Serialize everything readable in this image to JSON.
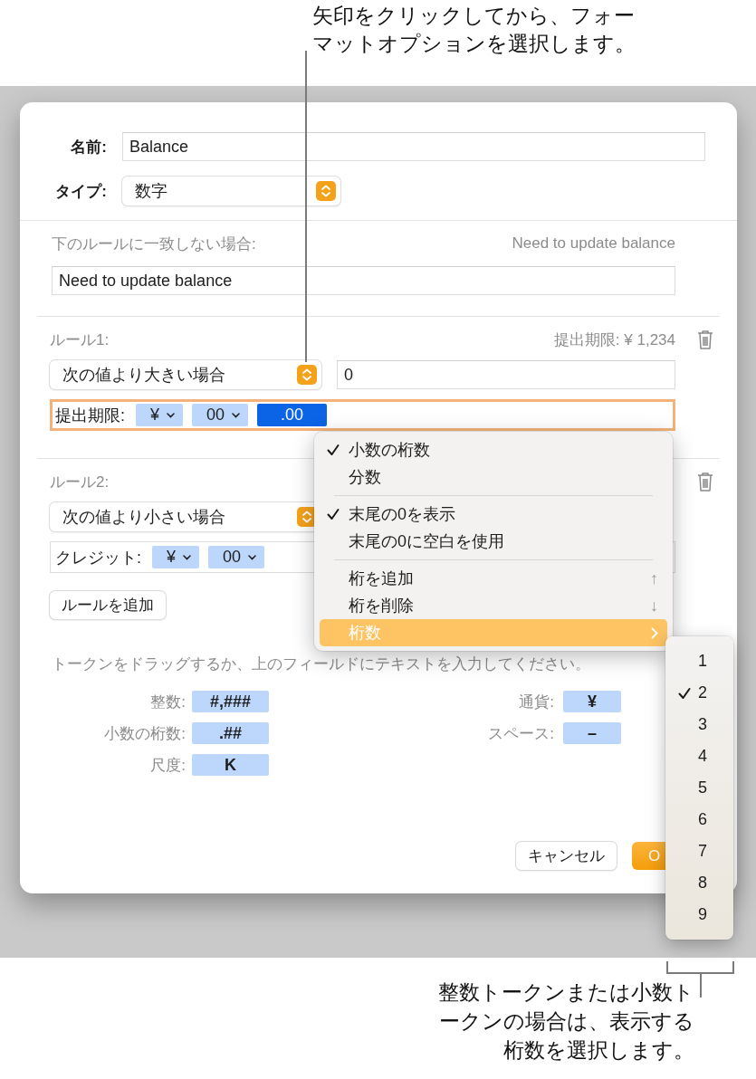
{
  "callout_top": "矢印をクリックしてから、フォーマットオプションを選択します。",
  "dialog": {
    "name": {
      "label": "名前:",
      "value": "Balance"
    },
    "type": {
      "label": "タイプ:",
      "value": "数字"
    },
    "fallback": {
      "label": "下のルールに一致しない場合:",
      "preview": "Need to update balance",
      "value": "Need to update balance"
    },
    "rules": [
      {
        "label": "ルール1:",
        "preview": "提出期限: ¥ 1,234",
        "condition": "次の値より大きい場合",
        "value": "0",
        "format_label": "提出期限:",
        "focused": true,
        "tokens": [
          {
            "text": "¥",
            "dropdown": true,
            "selected": false
          },
          {
            "text": "00",
            "dropdown": true,
            "selected": false
          },
          {
            "text": ".00",
            "dropdown": false,
            "selected": true
          }
        ]
      },
      {
        "label": "ルール2:",
        "condition": "次の値より小さい場合",
        "format_label": "クレジット:",
        "focused": false,
        "tokens": [
          {
            "text": "¥",
            "dropdown": true,
            "selected": false
          },
          {
            "text": "00",
            "dropdown": true,
            "selected": false
          }
        ]
      }
    ],
    "add_rule": "ルールを追加",
    "hint": "トークンをドラッグするか、上のフィールドにテキストを入力してください。",
    "palette_left": [
      {
        "label": "整数:",
        "token": "#,###"
      },
      {
        "label": "小数の桁数:",
        "token": ".##"
      },
      {
        "label": "尺度:",
        "token": "K"
      }
    ],
    "palette_right": [
      {
        "label": "通貨:",
        "token": "¥"
      },
      {
        "label": "スペース:",
        "token": "–"
      }
    ],
    "buttons": [
      {
        "label": "キャンセル",
        "kind": "cancel"
      },
      {
        "label": "O",
        "kind": "default"
      }
    ]
  },
  "format_menu": [
    {
      "kind": "item",
      "label": "小数の桁数",
      "checked": true,
      "highlighted": false
    },
    {
      "kind": "item",
      "label": "分数",
      "checked": false,
      "highlighted": false
    },
    {
      "kind": "separator"
    },
    {
      "kind": "item",
      "label": "末尾の0を表示",
      "checked": true,
      "highlighted": false
    },
    {
      "kind": "item",
      "label": "末尾の0に空白を使用",
      "checked": false,
      "highlighted": false
    },
    {
      "kind": "separator"
    },
    {
      "kind": "item",
      "label": "桁を追加",
      "checked": false,
      "highlighted": false,
      "shortcut": "↑"
    },
    {
      "kind": "item",
      "label": "桁を削除",
      "checked": false,
      "highlighted": false,
      "shortcut": "↓"
    },
    {
      "kind": "submenu",
      "label": "桁数",
      "checked": false,
      "highlighted": true
    }
  ],
  "digits_menu": [
    {
      "label": "1",
      "checked": false
    },
    {
      "label": "2",
      "checked": true
    },
    {
      "label": "3",
      "checked": false
    },
    {
      "label": "4",
      "checked": false
    },
    {
      "label": "5",
      "checked": false
    },
    {
      "label": "6",
      "checked": false
    },
    {
      "label": "7",
      "checked": false
    },
    {
      "label": "8",
      "checked": false
    },
    {
      "label": "9",
      "checked": false
    }
  ],
  "callout_bottom": "整数トークンまたは小数トークンの場合は、表示する桁数を選択します。"
}
